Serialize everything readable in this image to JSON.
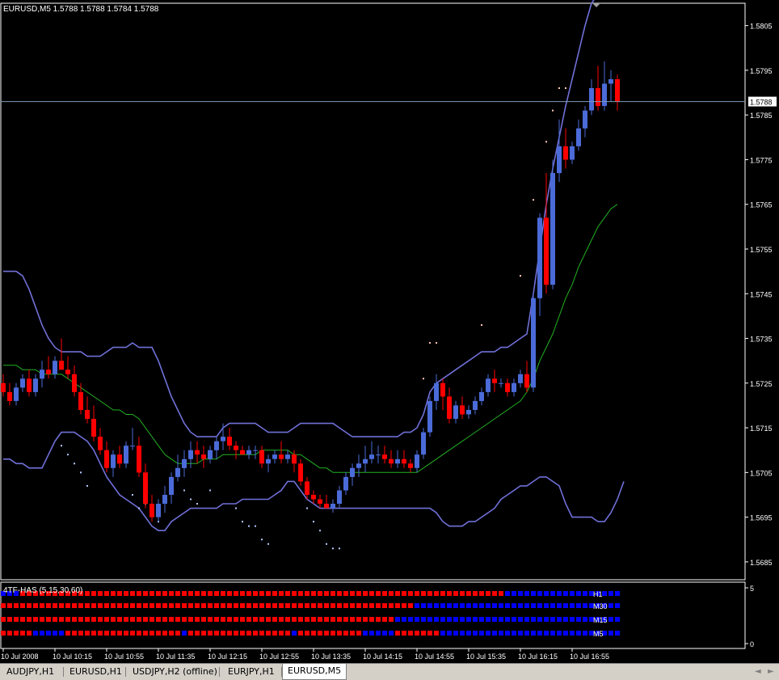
{
  "tabs": [
    {
      "label": "AUDJPY,H1",
      "active": false
    },
    {
      "label": "EURUSD,H1",
      "active": false
    },
    {
      "label": "USDJPY,H2 (offline)",
      "active": false
    },
    {
      "label": "EURJPY,H1",
      "active": false
    },
    {
      "label": "EURUSD,M5",
      "active": true
    }
  ],
  "tab_nav": {
    "left": "◄",
    "right": "►"
  },
  "chart_data": {
    "type": "candlestick",
    "title": "EURUSD,M5  1.5788 1.5788 1.5784 1.5788",
    "symbol": "EURUSD",
    "timeframe": "M5",
    "ohlc_header": {
      "open": "1.5788",
      "high": "1.5788",
      "low": "1.5784",
      "close": "1.5788"
    },
    "current_price": "1.5788",
    "ylim": [
      1.5681,
      1.581
    ],
    "y_ticks": [
      "1.5805",
      "1.5795",
      "1.5785",
      "1.5775",
      "1.5765",
      "1.5755",
      "1.5745",
      "1.5735",
      "1.5725",
      "1.5715",
      "1.5705",
      "1.5695",
      "1.5685"
    ],
    "x_ticks": [
      "10 Jul 2008",
      "10 Jul 10:15",
      "10 Jul 10:55",
      "10 Jul 11:35",
      "10 Jul 12:15",
      "10 Jul 12:55",
      "10 Jul 13:35",
      "10 Jul 14:15",
      "10 Jul 14:55",
      "10 Jul 15:35",
      "10 Jul 16:15",
      "10 Jul 16:55"
    ],
    "colors": {
      "bull": "#4b6bd8",
      "bear": "#ff0000",
      "bands": "#7070d8",
      "middle": "#22b022",
      "dots": "#ffc8b4",
      "dots_low": "#b4c8ff",
      "grid_text": "#ffffff"
    },
    "candles": [
      [
        1.5725,
        1.5727,
        1.5722,
        1.5723
      ],
      [
        1.5723,
        1.5725,
        1.572,
        1.5721
      ],
      [
        1.5721,
        1.5725,
        1.572,
        1.5724
      ],
      [
        1.5724,
        1.5727,
        1.5723,
        1.5726
      ],
      [
        1.5726,
        1.5728,
        1.5722,
        1.5723
      ],
      [
        1.5723,
        1.5727,
        1.5722,
        1.5726
      ],
      [
        1.5726,
        1.573,
        1.5724,
        1.5728
      ],
      [
        1.5728,
        1.5731,
        1.5726,
        1.5727
      ],
      [
        1.5727,
        1.5731,
        1.5726,
        1.573
      ],
      [
        1.573,
        1.5735,
        1.5728,
        1.5728
      ],
      [
        1.5728,
        1.5731,
        1.5726,
        1.5727
      ],
      [
        1.5727,
        1.5729,
        1.5722,
        1.5723
      ],
      [
        1.5723,
        1.5725,
        1.5718,
        1.5719
      ],
      [
        1.5719,
        1.5722,
        1.5716,
        1.5717
      ],
      [
        1.5717,
        1.572,
        1.5712,
        1.5713
      ],
      [
        1.5713,
        1.5715,
        1.5709,
        1.571
      ],
      [
        1.571,
        1.5712,
        1.5705,
        1.5706
      ],
      [
        1.5706,
        1.571,
        1.5704,
        1.5709
      ],
      [
        1.5709,
        1.5711,
        1.5706,
        1.5707
      ],
      [
        1.5707,
        1.5712,
        1.5706,
        1.5711
      ],
      [
        1.5711,
        1.5715,
        1.571,
        1.5711
      ],
      [
        1.5711,
        1.5713,
        1.5704,
        1.5705
      ],
      [
        1.5705,
        1.5707,
        1.5697,
        1.5698
      ],
      [
        1.5698,
        1.57,
        1.5694,
        1.5695
      ],
      [
        1.5695,
        1.5699,
        1.5694,
        1.5698
      ],
      [
        1.5698,
        1.5702,
        1.5696,
        1.57
      ],
      [
        1.57,
        1.5705,
        1.5698,
        1.5704
      ],
      [
        1.5704,
        1.5709,
        1.5703,
        1.5706
      ],
      [
        1.5706,
        1.571,
        1.5704,
        1.5708
      ],
      [
        1.5708,
        1.5712,
        1.5706,
        1.571
      ],
      [
        1.571,
        1.5712,
        1.5707,
        1.5709
      ],
      [
        1.5709,
        1.5711,
        1.5706,
        1.5708
      ],
      [
        1.5708,
        1.5711,
        1.5707,
        1.571
      ],
      [
        1.571,
        1.5713,
        1.5708,
        1.5712
      ],
      [
        1.5712,
        1.5716,
        1.571,
        1.5713
      ],
      [
        1.5713,
        1.5715,
        1.571,
        1.5711
      ],
      [
        1.5711,
        1.5712,
        1.5708,
        1.571
      ],
      [
        1.571,
        1.5711,
        1.5709,
        1.5709
      ],
      [
        1.5709,
        1.5711,
        1.5708,
        1.571
      ],
      [
        1.571,
        1.5711,
        1.5708,
        1.571
      ],
      [
        1.571,
        1.5711,
        1.5706,
        1.5707
      ],
      [
        1.5707,
        1.5709,
        1.5705,
        1.5708
      ],
      [
        1.5708,
        1.571,
        1.5707,
        1.5709
      ],
      [
        1.5709,
        1.5712,
        1.5707,
        1.5708
      ],
      [
        1.5708,
        1.571,
        1.5707,
        1.5709
      ],
      [
        1.5709,
        1.571,
        1.5705,
        1.5707
      ],
      [
        1.5707,
        1.5708,
        1.5702,
        1.5703
      ],
      [
        1.5703,
        1.5704,
        1.5699,
        1.57
      ],
      [
        1.57,
        1.5701,
        1.5698,
        1.5699
      ],
      [
        1.5699,
        1.57,
        1.5697,
        1.5698
      ],
      [
        1.5698,
        1.57,
        1.5697,
        1.5697
      ],
      [
        1.5697,
        1.5699,
        1.5696,
        1.5698
      ],
      [
        1.5698,
        1.5702,
        1.5697,
        1.5701
      ],
      [
        1.5701,
        1.5705,
        1.57,
        1.5704
      ],
      [
        1.5704,
        1.5707,
        1.5702,
        1.5706
      ],
      [
        1.5706,
        1.5709,
        1.5704,
        1.5707
      ],
      [
        1.5707,
        1.5711,
        1.5705,
        1.5708
      ],
      [
        1.5708,
        1.5712,
        1.5707,
        1.5709
      ],
      [
        1.5709,
        1.5711,
        1.5707,
        1.5709
      ],
      [
        1.5709,
        1.5711,
        1.5707,
        1.5708
      ],
      [
        1.5708,
        1.571,
        1.5706,
        1.5707
      ],
      [
        1.5707,
        1.571,
        1.5706,
        1.5708
      ],
      [
        1.5708,
        1.571,
        1.5706,
        1.5707
      ],
      [
        1.5707,
        1.5708,
        1.5705,
        1.5706
      ],
      [
        1.5706,
        1.571,
        1.5705,
        1.5709
      ],
      [
        1.5709,
        1.5715,
        1.5708,
        1.5714
      ],
      [
        1.5714,
        1.5722,
        1.5713,
        1.5721
      ],
      [
        1.5721,
        1.5727,
        1.5719,
        1.5725
      ],
      [
        1.5725,
        1.5726,
        1.5719,
        1.5722
      ],
      [
        1.5722,
        1.5724,
        1.5716,
        1.5717
      ],
      [
        1.5717,
        1.5721,
        1.5716,
        1.572
      ],
      [
        1.572,
        1.5722,
        1.5717,
        1.5718
      ],
      [
        1.5718,
        1.572,
        1.5717,
        1.5719
      ],
      [
        1.5719,
        1.5722,
        1.5718,
        1.5721
      ],
      [
        1.5721,
        1.5724,
        1.572,
        1.5723
      ],
      [
        1.5723,
        1.5727,
        1.5722,
        1.5726
      ],
      [
        1.5726,
        1.5728,
        1.5723,
        1.5725
      ],
      [
        1.5725,
        1.5726,
        1.5724,
        1.5725
      ],
      [
        1.5725,
        1.5726,
        1.5722,
        1.5723
      ],
      [
        1.5723,
        1.5726,
        1.5722,
        1.5725
      ],
      [
        1.5725,
        1.5728,
        1.5724,
        1.5727
      ],
      [
        1.5727,
        1.573,
        1.5723,
        1.5724
      ],
      [
        1.5724,
        1.5745,
        1.5723,
        1.5744
      ],
      [
        1.5744,
        1.5763,
        1.574,
        1.5762
      ],
      [
        1.5762,
        1.5772,
        1.5745,
        1.5747
      ],
      [
        1.5747,
        1.5775,
        1.5746,
        1.5772
      ],
      [
        1.5772,
        1.5784,
        1.577,
        1.5778
      ],
      [
        1.5778,
        1.5782,
        1.5773,
        1.5775
      ],
      [
        1.5775,
        1.5779,
        1.5774,
        1.5778
      ],
      [
        1.5778,
        1.5784,
        1.5777,
        1.5782
      ],
      [
        1.5782,
        1.5787,
        1.578,
        1.5786
      ],
      [
        1.5786,
        1.5793,
        1.5785,
        1.5791
      ],
      [
        1.5791,
        1.5796,
        1.5786,
        1.5787
      ],
      [
        1.5787,
        1.5797,
        1.5786,
        1.5792
      ],
      [
        1.5792,
        1.5795,
        1.5788,
        1.5793
      ],
      [
        1.5793,
        1.5794,
        1.5786,
        1.5788
      ]
    ],
    "upper_band": [
      1.575,
      1.575,
      1.575,
      1.5749,
      1.5746,
      1.5742,
      1.5738,
      1.5735,
      1.5733,
      1.5732,
      1.5732,
      1.5732,
      1.5732,
      1.5731,
      1.5731,
      1.5731,
      1.5732,
      1.5733,
      1.5733,
      1.5733,
      1.5734,
      1.5733,
      1.5733,
      1.5733,
      1.573,
      1.5726,
      1.5722,
      1.5719,
      1.5716,
      1.5714,
      1.5713,
      1.5713,
      1.5713,
      1.5713,
      1.5715,
      1.5716,
      1.5716,
      1.5716,
      1.5716,
      1.5716,
      1.5715,
      1.5714,
      1.5714,
      1.5714,
      1.5714,
      1.5715,
      1.5716,
      1.5716,
      1.5716,
      1.5716,
      1.5716,
      1.5716,
      1.5715,
      1.5714,
      1.5713,
      1.5713,
      1.5713,
      1.5713,
      1.5713,
      1.5713,
      1.5713,
      1.5713,
      1.5714,
      1.5714,
      1.5715,
      1.5718,
      1.5723,
      1.5725,
      1.5726,
      1.5727,
      1.5728,
      1.5729,
      1.573,
      1.5731,
      1.5732,
      1.5732,
      1.5732,
      1.5733,
      1.5733,
      1.5734,
      1.5735,
      1.5736,
      1.5745,
      1.5755,
      1.5765,
      1.5773,
      1.578,
      1.5787,
      1.5793,
      1.5799,
      1.5805,
      1.581,
      1.5812,
      1.5813,
      1.5813,
      1.5813
    ],
    "middle_band": [
      1.5729,
      1.5729,
      1.5729,
      1.5728,
      1.5728,
      1.5728,
      1.5727,
      1.5727,
      1.5727,
      1.5727,
      1.5726,
      1.5725,
      1.5724,
      1.5723,
      1.5722,
      1.5721,
      1.572,
      1.5719,
      1.5719,
      1.5718,
      1.5718,
      1.5717,
      1.5715,
      1.5713,
      1.5711,
      1.5709,
      1.5708,
      1.5707,
      1.5707,
      1.5707,
      1.5707,
      1.5708,
      1.5708,
      1.5708,
      1.5709,
      1.5709,
      1.5709,
      1.5709,
      1.5709,
      1.5709,
      1.571,
      1.571,
      1.571,
      1.571,
      1.571,
      1.5709,
      1.5709,
      1.5708,
      1.5707,
      1.5706,
      1.5706,
      1.5705,
      1.5705,
      1.5705,
      1.5705,
      1.5705,
      1.5705,
      1.5705,
      1.5705,
      1.5705,
      1.5705,
      1.5705,
      1.5705,
      1.5705,
      1.5705,
      1.5706,
      1.5707,
      1.5708,
      1.5709,
      1.571,
      1.5711,
      1.5712,
      1.5713,
      1.5714,
      1.5715,
      1.5716,
      1.5717,
      1.5718,
      1.5719,
      1.572,
      1.5721,
      1.5723,
      1.5726,
      1.573,
      1.5733,
      1.5736,
      1.574,
      1.5744,
      1.5747,
      1.5751,
      1.5754,
      1.5757,
      1.576,
      1.5762,
      1.5764,
      1.5765
    ],
    "lower_band": [
      1.5708,
      1.5708,
      1.5707,
      1.5707,
      1.5706,
      1.5706,
      1.5706,
      1.5709,
      1.5712,
      1.5714,
      1.5714,
      1.5714,
      1.5713,
      1.5712,
      1.571,
      1.5707,
      1.5704,
      1.5702,
      1.57,
      1.5699,
      1.5698,
      1.5697,
      1.5695,
      1.5693,
      1.5692,
      1.5692,
      1.5694,
      1.5695,
      1.5696,
      1.5697,
      1.5697,
      1.5697,
      1.5697,
      1.5697,
      1.5698,
      1.5698,
      1.5698,
      1.5699,
      1.5699,
      1.5699,
      1.5699,
      1.5699,
      1.57,
      1.5701,
      1.5703,
      1.5703,
      1.5701,
      1.5699,
      1.5698,
      1.5697,
      1.5697,
      1.5697,
      1.5697,
      1.5697,
      1.5697,
      1.5697,
      1.5697,
      1.5697,
      1.5697,
      1.5697,
      1.5697,
      1.5697,
      1.5697,
      1.5697,
      1.5697,
      1.5697,
      1.5697,
      1.5696,
      1.5694,
      1.5693,
      1.5693,
      1.5693,
      1.5694,
      1.5694,
      1.5695,
      1.5696,
      1.5697,
      1.5699,
      1.57,
      1.5701,
      1.5702,
      1.5702,
      1.5703,
      1.5704,
      1.5704,
      1.5703,
      1.5702,
      1.5698,
      1.5695,
      1.5695,
      1.5695,
      1.5695,
      1.5694,
      1.5694,
      1.5696,
      1.5699,
      1.5703
    ],
    "dots_above": [
      [
        65,
        1.5726
      ],
      [
        66,
        1.5734
      ],
      [
        67,
        1.5734
      ],
      [
        74,
        1.5738
      ],
      [
        80,
        1.5749
      ],
      [
        82,
        1.5766
      ],
      [
        84,
        1.5779
      ],
      [
        85,
        1.5786
      ],
      [
        86,
        1.5791
      ],
      [
        87,
        1.5791
      ]
    ],
    "dots_below": [
      [
        9,
        1.5711
      ],
      [
        10,
        1.5709
      ],
      [
        11,
        1.5707
      ],
      [
        12,
        1.5705
      ],
      [
        13,
        1.5702
      ],
      [
        20,
        1.57
      ],
      [
        21,
        1.5697
      ],
      [
        22,
        1.5698
      ],
      [
        23,
        1.5696
      ],
      [
        24,
        1.5694
      ],
      [
        28,
        1.5701
      ],
      [
        29,
        1.5699
      ],
      [
        30,
        1.5698
      ],
      [
        32,
        1.5701
      ],
      [
        36,
        1.5697
      ],
      [
        37,
        1.5694
      ],
      [
        38,
        1.5693
      ],
      [
        39,
        1.5693
      ],
      [
        40,
        1.569
      ],
      [
        41,
        1.5689
      ],
      [
        47,
        1.5697
      ],
      [
        48,
        1.5694
      ],
      [
        49,
        1.5692
      ],
      [
        50,
        1.5689
      ],
      [
        51,
        1.5688
      ],
      [
        52,
        1.5688
      ]
    ],
    "indicator": {
      "title": "4TF-HAS (5,15,30,60)",
      "y_ticks": [
        "5",
        "0"
      ],
      "rows": [
        {
          "label": "H1",
          "segments": [
            {
              "color": "blue",
              "count": 3
            },
            {
              "color": "red",
              "count": 75
            },
            {
              "color": "blue",
              "count": 18
            }
          ]
        },
        {
          "label": "M30",
          "segments": [
            {
              "color": "red",
              "count": 64
            },
            {
              "color": "blue",
              "count": 32
            }
          ]
        },
        {
          "label": "M15",
          "segments": [
            {
              "color": "red",
              "count": 61
            },
            {
              "color": "blue",
              "count": 35
            }
          ]
        },
        {
          "label": "M5",
          "segments": [
            {
              "color": "red",
              "count": 5
            },
            {
              "color": "blue",
              "count": 5
            },
            {
              "color": "red",
              "count": 18
            },
            {
              "color": "blue",
              "count": 1
            },
            {
              "color": "red",
              "count": 16
            },
            {
              "color": "blue",
              "count": 1
            },
            {
              "color": "red",
              "count": 10
            },
            {
              "color": "blue",
              "count": 5
            },
            {
              "color": "red",
              "count": 7
            },
            {
              "color": "blue",
              "count": 28
            }
          ]
        }
      ]
    }
  }
}
